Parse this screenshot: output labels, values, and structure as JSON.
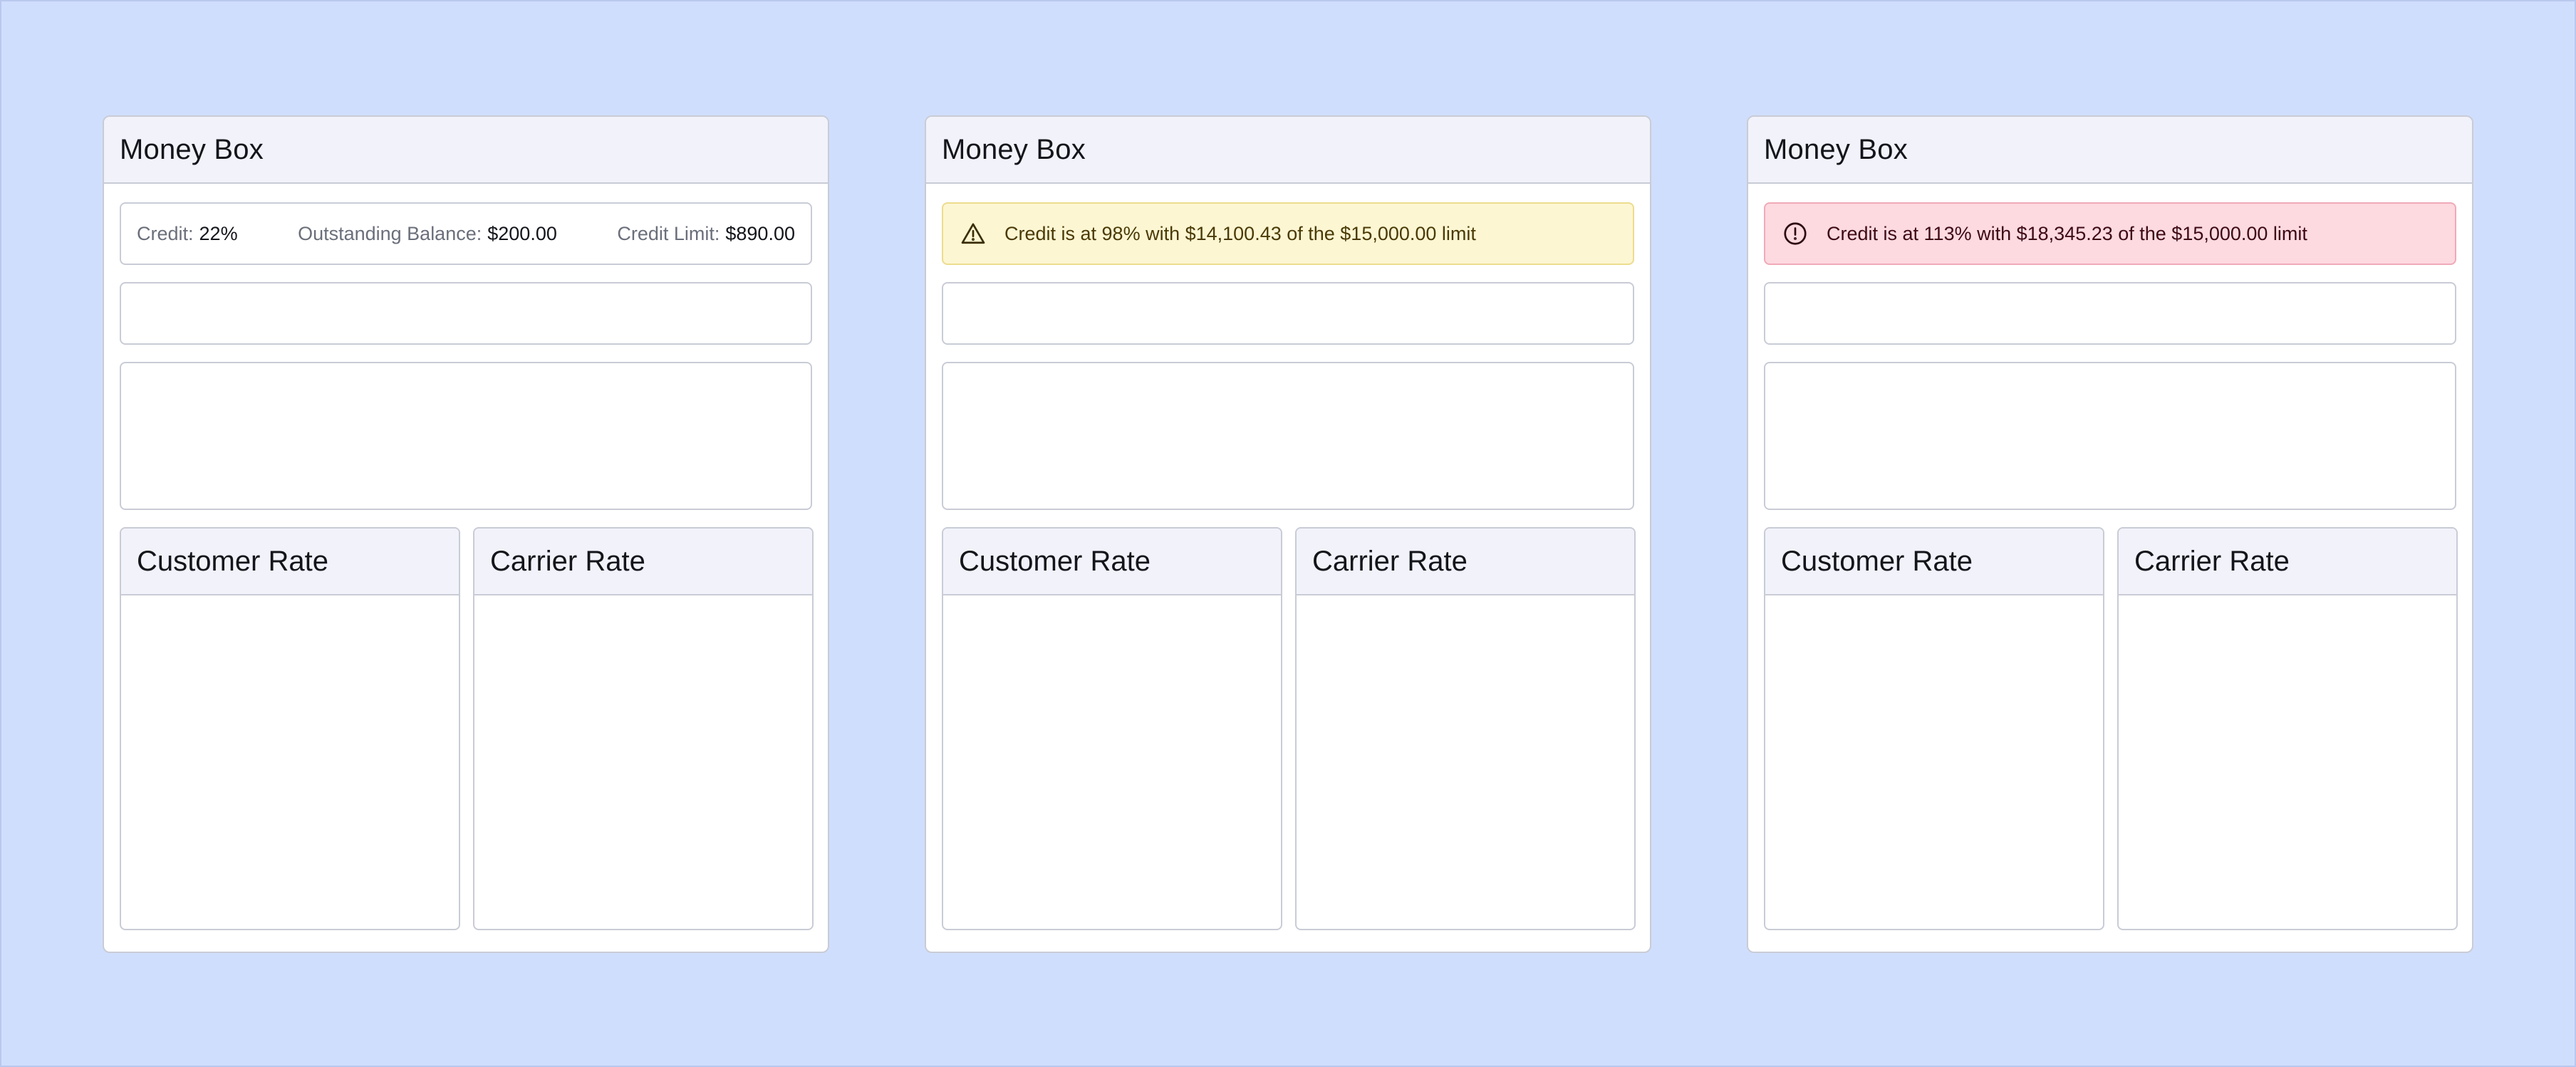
{
  "colors": {
    "page_background": "#d0defd",
    "card_header": "#f1f2fa",
    "border": "#c9ccd6",
    "warning_background": "#fdf6d3",
    "danger_background": "#fdd9e0"
  },
  "cards": [
    {
      "title": "Money Box",
      "credit_summary": {
        "credit_label": "Credit:",
        "credit_value": "22%",
        "outstanding_label": "Outstanding Balance:",
        "outstanding_value": "$200.00",
        "limit_label": "Credit Limit:",
        "limit_value": "$890.00"
      },
      "customer_rate_title": "Customer Rate",
      "carrier_rate_title": "Carrier Rate"
    },
    {
      "title": "Money Box",
      "alert": {
        "type": "warning",
        "icon": "warning-triangle-icon",
        "text": "Credit is at 98% with $14,100.43 of the $15,000.00 limit"
      },
      "customer_rate_title": "Customer Rate",
      "carrier_rate_title": "Carrier Rate"
    },
    {
      "title": "Money Box",
      "alert": {
        "type": "danger",
        "icon": "alert-circle-icon",
        "text": "Credit is at 113% with $18,345.23 of the $15,000.00 limit"
      },
      "customer_rate_title": "Customer Rate",
      "carrier_rate_title": "Carrier Rate"
    }
  ]
}
